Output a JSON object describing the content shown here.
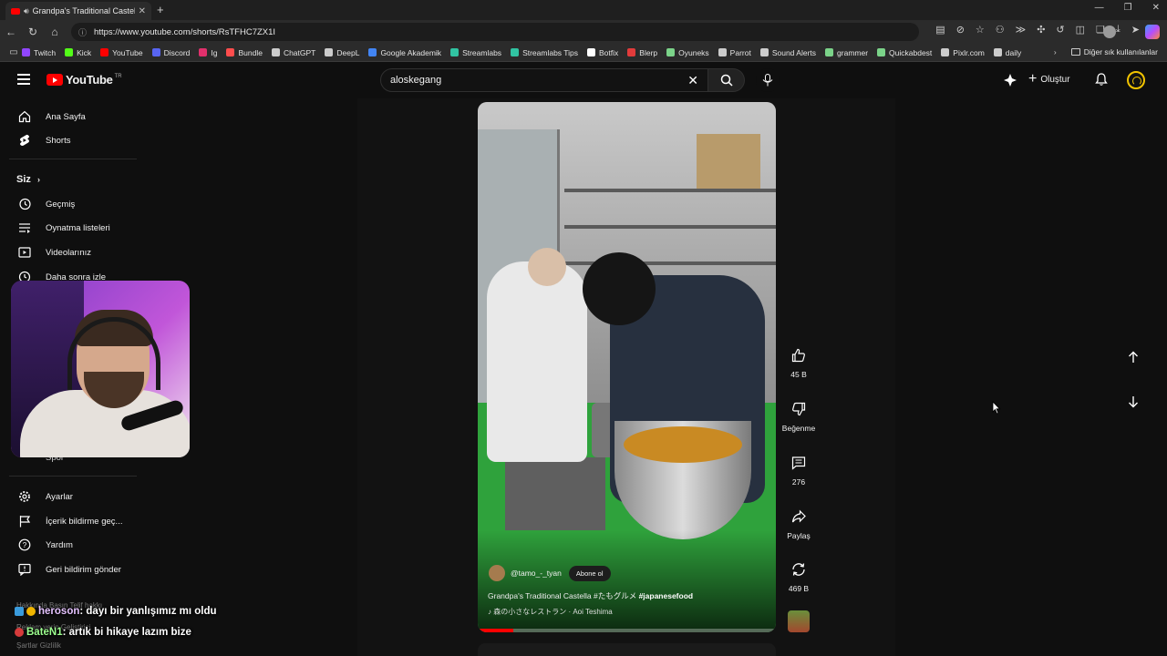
{
  "browser": {
    "tab_title": "Grandpa's Traditional Castell",
    "url": "https://www.youtube.com/shorts/RsTFHC7ZX1I",
    "bookmarks": [
      "Twitch",
      "Kick",
      "YouTube",
      "Discord",
      "Ig",
      "Bundle",
      "ChatGPT",
      "DeepL",
      "Google Akademik",
      "Streamlabs",
      "Streamlabs Tips",
      "Botfix",
      "Blerp",
      "Oyuneks",
      "Parrot",
      "Sound Alerts",
      "grammer",
      "Quickabdest",
      "Pixlr.com",
      "daily"
    ],
    "bookmark_colors": [
      "#9146ff",
      "#53fc18",
      "#ff0000",
      "#5865f2",
      "#e1306c",
      "#ff4d4d",
      "#cccccc",
      "#cccccc",
      "#4285f4",
      "#31c3a2",
      "#31c3a2",
      "#ffffff",
      "#e23b3b",
      "#7bd389",
      "#cccccc",
      "#cccccc",
      "#7bd389",
      "#7bd389",
      "#cccccc",
      "#cccccc"
    ],
    "other_bookmarks": "Diğer sık kullanılanlar"
  },
  "masthead": {
    "logo_text": "YouTube",
    "logo_region": "TR",
    "search_value": "aloskegang",
    "create_label": "Oluştur"
  },
  "sidebar": {
    "primary": [
      {
        "label": "Ana Sayfa",
        "icon": "home-icon"
      },
      {
        "label": "Shorts",
        "icon": "shorts-icon"
      }
    ],
    "you_header": "Siz",
    "you_items": [
      {
        "label": "Geçmiş",
        "icon": "history-icon"
      },
      {
        "label": "Oynatma listeleri",
        "icon": "playlist-icon"
      },
      {
        "label": "Videolarınız",
        "icon": "your-videos-icon"
      },
      {
        "label": "Daha sonra izle",
        "icon": "watch-later-icon"
      }
    ],
    "partial_item": "Spor",
    "settings_items": [
      {
        "label": "Ayarlar",
        "icon": "gear-icon"
      },
      {
        "label": "İçerik bildirme geç...",
        "icon": "flag-icon"
      },
      {
        "label": "Yardım",
        "icon": "help-icon"
      },
      {
        "label": "Geri bildirim gönder",
        "icon": "feedback-icon"
      }
    ],
    "footer_line1": "Hakkında  Basın  Telif hakkı",
    "footer_line2": "Reklam verin  Geliştirici",
    "footer_line3": "Şartlar  Gizlilik"
  },
  "short": {
    "channel": "@tamo_-_tyan",
    "subscribe_label": "Abone ol",
    "title": "Grandpa's Traditional Castella #たもグルメ ",
    "title_tag": "#japanesefood",
    "music": "♪ 森の小さなレストラン · Aoi Teshima",
    "progress": 0.12,
    "likes": "45 B",
    "dislike_label": "Beğenme",
    "comments": "276",
    "share_label": "Paylaş",
    "remix_count": "469 B"
  },
  "chat": [
    {
      "user": "heroson",
      "message": " : dayı bir yanlışımız mı oldu",
      "user_color": "#e5c3ff"
    },
    {
      "user": "BateN1",
      "message": " : artık bi hikaye lazım bize",
      "user_color": "#9dff8f"
    }
  ]
}
